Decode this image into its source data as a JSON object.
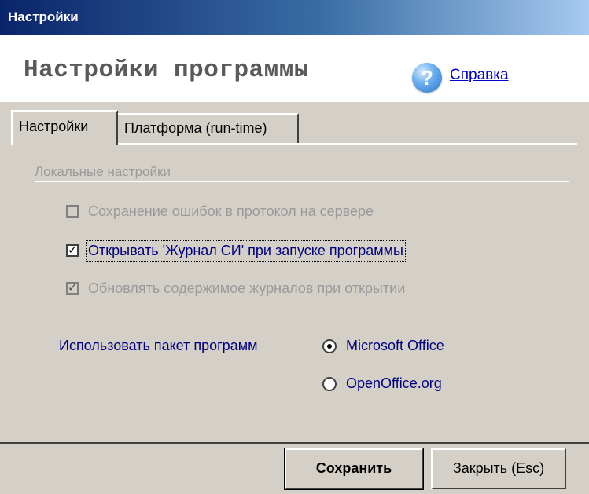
{
  "window": {
    "title": "Настройки"
  },
  "header": {
    "title": "Настройки программы",
    "help_icon": "help-question-icon",
    "help_label": "Справка"
  },
  "tabs": [
    {
      "label": "Настройки",
      "active": true
    },
    {
      "label": "Платформа (run-time)",
      "active": false
    }
  ],
  "group": {
    "title": "Локальные настройки"
  },
  "checkboxes": [
    {
      "label": "Сохранение ошибок в протокол на сервере",
      "checked": false,
      "enabled": false
    },
    {
      "label": "Открывать 'Журнал СИ' при запуске программы",
      "checked": true,
      "enabled": true,
      "focused": true
    },
    {
      "label": "Обновлять содержимое журналов при открытии",
      "checked": true,
      "enabled": false
    }
  ],
  "office_package": {
    "label": "Использовать пакет программ",
    "options": [
      {
        "label": "Microsoft Office",
        "selected": true
      },
      {
        "label": "OpenOffice.org",
        "selected": false
      }
    ]
  },
  "buttons": {
    "save": "Сохранить",
    "close": "Закрыть (Esc)"
  },
  "colors": {
    "dialog_bg": "#d4d0c8",
    "titlebar_start": "#0a246a",
    "titlebar_end": "#a6caf0",
    "label_color": "#000080",
    "disabled_color": "#9a9a9a",
    "link_color": "#0000cc"
  }
}
